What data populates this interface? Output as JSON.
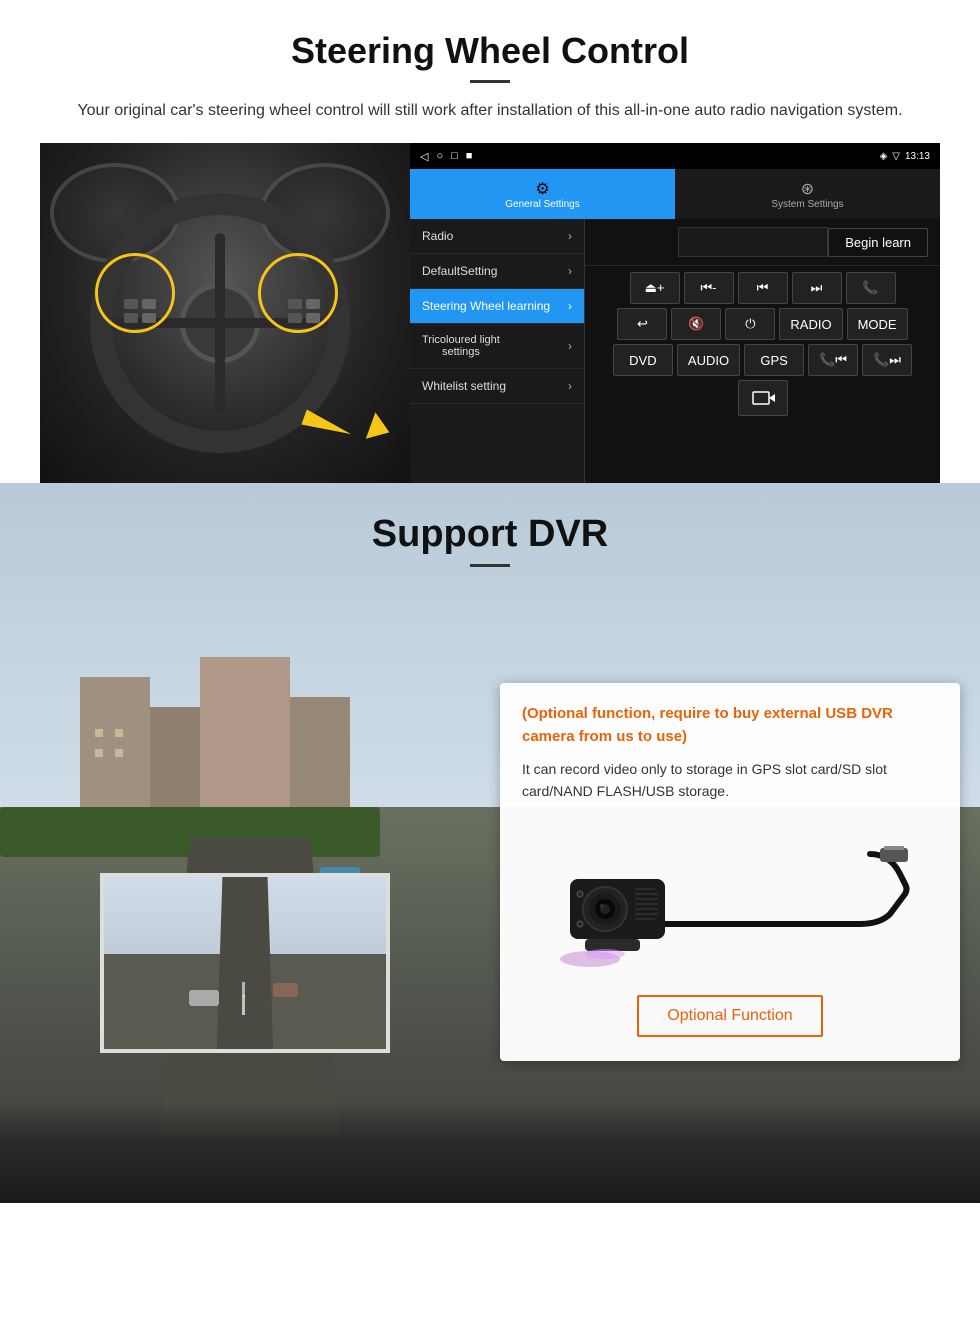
{
  "page": {
    "steering": {
      "title": "Steering Wheel Control",
      "subtitle": "Your original car's steering wheel control will still work after installation of this all-in-one auto radio navigation system.",
      "android": {
        "status_bar": {
          "time": "13:13",
          "signal": "▼ ▲"
        },
        "nav_buttons": [
          "◁",
          "○",
          "□",
          "■"
        ],
        "tab_general": "General Settings",
        "tab_system": "System Settings",
        "menu_items": [
          {
            "label": "Radio",
            "active": false
          },
          {
            "label": "DefaultSetting",
            "active": false
          },
          {
            "label": "Steering Wheel learning",
            "active": true
          },
          {
            "label": "Tricoloured light settings",
            "active": false
          },
          {
            "label": "Whitelist setting",
            "active": false
          }
        ],
        "begin_learn": "Begin learn",
        "control_buttons": [
          [
            "vol_up",
            "vol_down",
            "prev_track",
            "next_track",
            "phone"
          ],
          [
            "hang_up",
            "mute",
            "power",
            "RADIO",
            "MODE"
          ],
          [
            "DVD",
            "AUDIO",
            "GPS",
            "phone_prev",
            "phone_next"
          ],
          [
            "dvr_cam"
          ]
        ]
      }
    },
    "dvr": {
      "title": "Support DVR",
      "optional_text": "(Optional function, require to buy external USB DVR camera from us to use)",
      "description": "It can record video only to storage in GPS slot card/SD slot card/NAND FLASH/USB storage.",
      "optional_function_label": "Optional Function"
    }
  }
}
